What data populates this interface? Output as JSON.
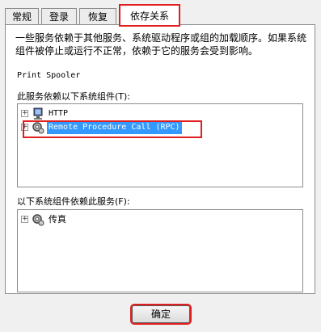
{
  "tabs": [
    {
      "label": "常规"
    },
    {
      "label": "登录"
    },
    {
      "label": "恢复"
    },
    {
      "label": "依存关系"
    }
  ],
  "description": "一些服务依赖于其他服务、系统驱动程序或组的加载顺序。如果系统组件被停止或运行不正常，依赖于它的服务会受到影响。",
  "service_name": "Print Spooler",
  "depends_on": {
    "label": "此服务依赖以下系统组件(T):",
    "items": [
      {
        "label": "HTTP",
        "icon": "computer-icon"
      },
      {
        "label": "Remote Procedure Call (RPC)",
        "icon": "gear-service-icon",
        "selected": true
      }
    ]
  },
  "dependents": {
    "label": "以下系统组件依赖此服务(F):",
    "items": [
      {
        "label": "传真",
        "icon": "gear-service-icon"
      }
    ]
  },
  "buttons": {
    "ok": "确定"
  },
  "colors": {
    "highlight": "#3399ff",
    "annotation": "#e02020"
  }
}
